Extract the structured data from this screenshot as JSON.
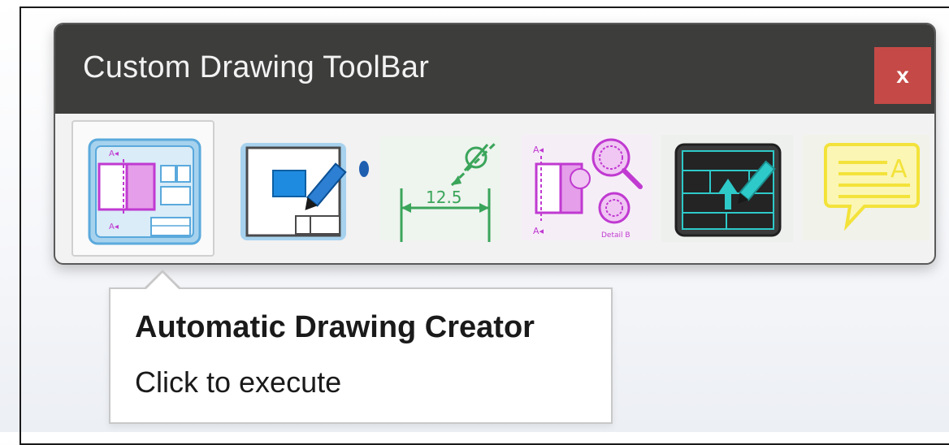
{
  "window": {
    "title": "Custom Drawing ToolBar",
    "close_label": "x"
  },
  "toolbar": {
    "buttons": [
      {
        "name": "automatic-drawing-creator",
        "icon": "drawing-sheet-views-icon",
        "selected": true
      },
      {
        "name": "edit-drawing-sheet",
        "icon": "sheet-edit-pencil-icon",
        "selected": false
      },
      {
        "name": "dimension-tool",
        "icon": "dimension-diameter-icon",
        "label": "12.5",
        "selected": false
      },
      {
        "name": "section-detail-views",
        "icon": "section-detail-magnifier-icon",
        "label": "Detail B",
        "selected": false
      },
      {
        "name": "title-block-editor",
        "icon": "title-block-edit-icon",
        "selected": false
      },
      {
        "name": "annotation-note",
        "icon": "note-callout-icon",
        "label": "A",
        "selected": false
      }
    ]
  },
  "tooltip": {
    "title": "Automatic Drawing Creator",
    "description": "Click to execute"
  },
  "colors": {
    "titlebar": "#3d3d3c",
    "close": "#c54a47",
    "magenta": "#c03ad1",
    "blue": "#2f8fd8",
    "green": "#3aa55a",
    "yellow": "#f3e23a"
  }
}
